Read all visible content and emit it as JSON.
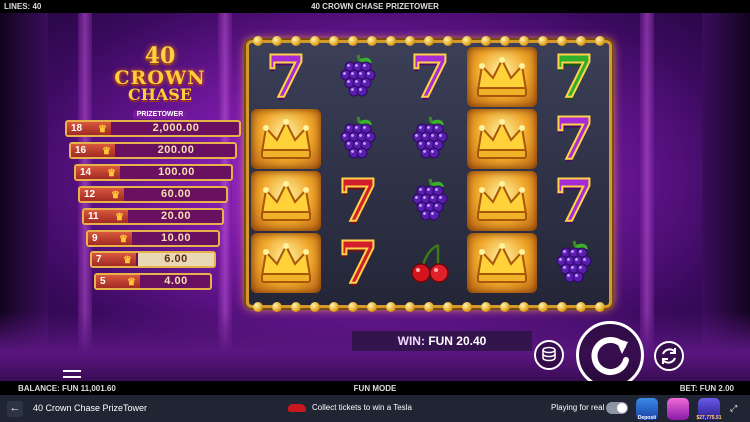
{
  "top": {
    "lines": "LINES: 40",
    "title": "40 CROWN CHASE PRIZETOWER"
  },
  "logo": {
    "number": "40",
    "line1": "CROWN",
    "line2": "CHASE",
    "sub": "PRIZETOWER"
  },
  "paytable": [
    {
      "count": "18",
      "value": "2,000.00",
      "active": false
    },
    {
      "count": "16",
      "value": "200.00",
      "active": false
    },
    {
      "count": "14",
      "value": "100.00",
      "active": false
    },
    {
      "count": "12",
      "value": "60.00",
      "active": false
    },
    {
      "count": "11",
      "value": "20.00",
      "active": false
    },
    {
      "count": "9",
      "value": "10.00",
      "active": false
    },
    {
      "count": "7",
      "value": "6.00",
      "active": true
    },
    {
      "count": "5",
      "value": "4.00",
      "active": false
    }
  ],
  "reels": [
    [
      "seven-purple",
      "crown",
      "crown",
      "crown"
    ],
    [
      "grapes",
      "grapes",
      "seven-red",
      "seven-red"
    ],
    [
      "seven-purple",
      "grapes",
      "grapes",
      "cherry"
    ],
    [
      "crown",
      "crown",
      "crown",
      "crown"
    ],
    [
      "seven-green",
      "seven-purple",
      "seven-purple",
      "grapes"
    ]
  ],
  "win": {
    "label": "WIN:",
    "value": "FUN 20.40"
  },
  "controls": {
    "spin_icon": "spin-arrow-icon",
    "coins_icon": "coin-stack-icon",
    "autoplay_icon": "autoplay-icon",
    "menu_icon": "menu-icon"
  },
  "status": {
    "balance": "BALANCE: FUN 11,001.60",
    "mode": "FUN MODE",
    "bet": "BET: FUN 2.00"
  },
  "footer": {
    "game_name": "40 Crown Chase PrizeTower",
    "promo": "Collect tickets to win a Tesla",
    "play_real": "Playing for real",
    "badge1": "Deposit",
    "badge3": "$27,775.51"
  },
  "colors": {
    "accent_gold": "#e7b24a",
    "frame_gold": "#d39a2b",
    "stage_purple": "#7a1aa8"
  }
}
